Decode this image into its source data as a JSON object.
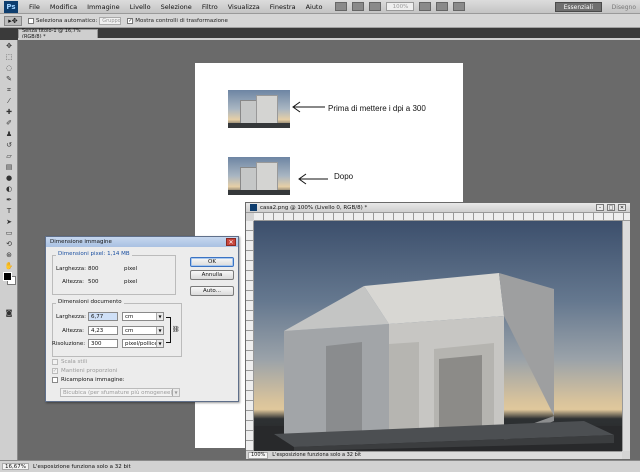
{
  "menubar": {
    "logo": "Ps",
    "items": [
      "File",
      "Modifica",
      "Immagine",
      "Livello",
      "Selezione",
      "Filtro",
      "Visualizza",
      "Finestra",
      "Aiuto"
    ],
    "zoom": "100%",
    "workspace_active": "Essenziali",
    "workspace_other": "Disegno"
  },
  "optionsbar": {
    "auto_select_label": "Seleziona automatico:",
    "auto_select_value": "Gruppo",
    "auto_select_checked": false,
    "transform_label": "Mostra controlli di trasformazione",
    "transform_checked": true
  },
  "document": {
    "tab_title": "Senza titolo-1 @ 16,7% (RGB/8) *",
    "annotation_before": "Prima di mettere i dpi a 300",
    "annotation_after": "Dopo"
  },
  "image_window": {
    "title": "casa2.png @ 100% (Livello 0, RGB/8) *",
    "zoom": "100%",
    "status": "L'esposizione funziona solo a 32 bit"
  },
  "dialog": {
    "title": "Dimensione immagine",
    "pixel_dims_label": "Dimensioni pixel:",
    "pixel_dims_value": "1,14 MB",
    "width_label": "Larghezza:",
    "width_px": "800",
    "height_label": "Altezza:",
    "height_px": "500",
    "unit_px": "pixel",
    "doc_dims_label": "Dimensioni documento",
    "doc_width": "6,77",
    "doc_height": "4,23",
    "doc_unit": "cm",
    "resolution_label": "Risoluzione:",
    "resolution": "300",
    "resolution_unit": "pixel/pollice",
    "ok": "OK",
    "cancel": "Annulla",
    "auto": "Auto...",
    "scale_styles": "Scala stili",
    "constrain": "Mantieni proporzioni",
    "resample": "Ricampiona immagine:",
    "resample_method": "Bicubica (per sfumature più omogenee)"
  },
  "statusbar": {
    "zoom": "16,67%",
    "message": "L'esposizione funziona solo a 32 bit"
  },
  "tools": {
    "icons": [
      "move-icon",
      "marquee-icon",
      "lasso-icon",
      "quick-select-icon",
      "crop-icon",
      "eyedropper-icon",
      "healing-icon",
      "brush-icon",
      "clone-stamp-icon",
      "history-brush-icon",
      "eraser-icon",
      "gradient-icon",
      "blur-icon",
      "dodge-icon",
      "pen-icon",
      "type-icon",
      "path-select-icon",
      "shape-icon",
      "3d-rotate-icon",
      "3d-orbit-icon",
      "hand-icon",
      "zoom-icon"
    ]
  }
}
